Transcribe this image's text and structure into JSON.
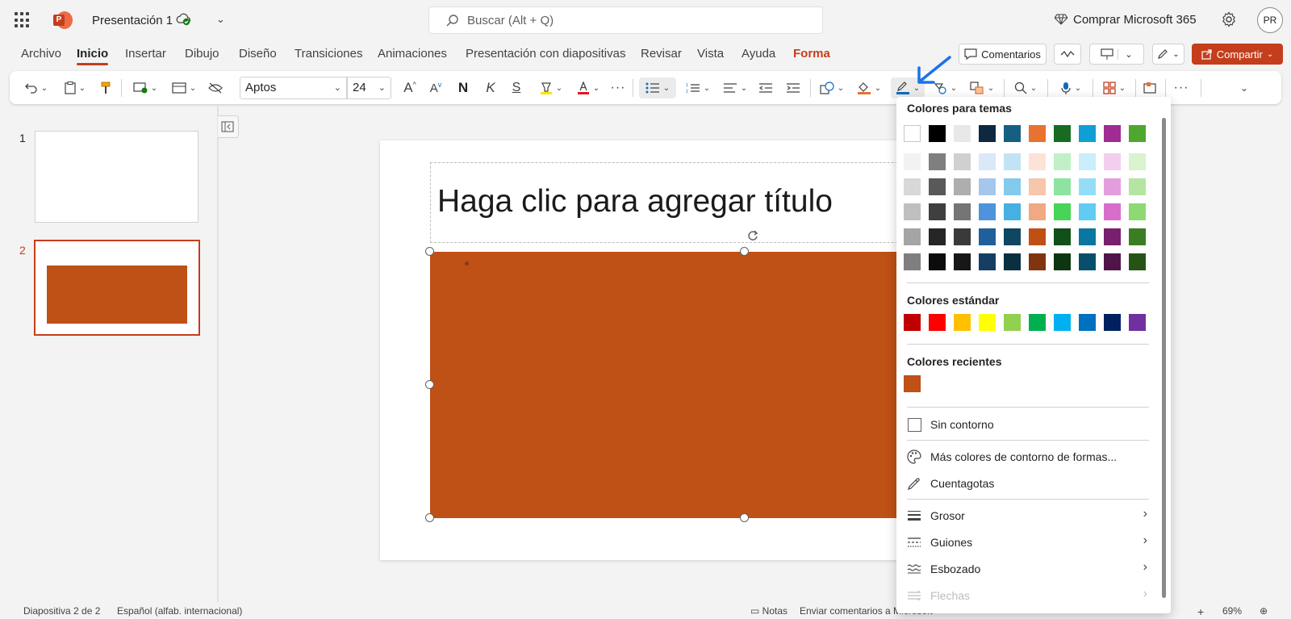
{
  "titlebar": {
    "doc_title": "Presentación 1",
    "search_placeholder": "Buscar (Alt + Q)",
    "buy_label": "Comprar Microsoft 365",
    "avatar_initials": "PR"
  },
  "menu": {
    "tabs": [
      "Archivo",
      "Inicio",
      "Insertar",
      "Dibujo",
      "Diseño",
      "Transiciones",
      "Animaciones",
      "Presentación con diapositivas",
      "Revisar",
      "Vista",
      "Ayuda",
      "Forma"
    ],
    "active_tab": "Inicio",
    "comments_label": "Comentarios",
    "share_label": "Compartir"
  },
  "ribbon": {
    "font_name": "Aptos",
    "font_size": "24",
    "bold_glyph": "N",
    "italic_glyph": "K",
    "strike_glyph": "S"
  },
  "slides": {
    "numbers": [
      "1",
      "2"
    ],
    "selected": "2"
  },
  "slide": {
    "title_placeholder": "Haga clic para agregar título",
    "shape_color": "#bf5016"
  },
  "panel": {
    "theme_heading": "Colores para temas",
    "standard_heading": "Colores estándar",
    "recent_heading": "Colores recientes",
    "theme_top_row": [
      "#ffffff",
      "#000000",
      "#e8e8e8",
      "#0e2841",
      "#156082",
      "#e97132",
      "#196b24",
      "#0f9ed5",
      "#a02b93",
      "#4ea72e"
    ],
    "theme_shades": [
      [
        "#f2f2f2",
        "#7f7f7f",
        "#d0d0d0",
        "#dbe8f7",
        "#c0e4f5",
        "#fbe3d6",
        "#c1f0c8",
        "#caeefb",
        "#f2cfee",
        "#d9f2d0"
      ],
      [
        "#d8d8d8",
        "#595959",
        "#aeaeae",
        "#a6c6ec",
        "#83caeb",
        "#f6c6ad",
        "#8ee3a0",
        "#95ddf7",
        "#e59edd",
        "#b4e5a2"
      ],
      [
        "#bfbfbf",
        "#3f3f3f",
        "#757575",
        "#4d94db",
        "#45b0e1",
        "#f1a983",
        "#47d459",
        "#61cbf3",
        "#d86ecc",
        "#8ed973"
      ],
      [
        "#a5a5a5",
        "#262626",
        "#3a3a3a",
        "#215f9a",
        "#0f4761",
        "#c04f15",
        "#12501a",
        "#0b76a0",
        "#78206e",
        "#3b7d23"
      ],
      [
        "#7f7f7f",
        "#0c0c0c",
        "#171717",
        "#163e64",
        "#0a2f40",
        "#80350e",
        "#0c3511",
        "#074f6a",
        "#4f1548",
        "#275317"
      ]
    ],
    "standard_colors": [
      "#c00000",
      "#ff0000",
      "#ffc000",
      "#ffff00",
      "#92d050",
      "#00b050",
      "#00b0f0",
      "#0070c0",
      "#002060",
      "#7030a0"
    ],
    "recent_colors": [
      "#bf5016"
    ],
    "items": {
      "no_outline": "Sin contorno",
      "more_colors": "Más colores de contorno de formas...",
      "eyedropper": "Cuentagotas",
      "weight": "Grosor",
      "dashes": "Guiones",
      "sketched": "Esbozado",
      "arrows": "Flechas"
    }
  },
  "status": {
    "slide_info": "Diapositiva 2 de 2",
    "language": "Español (alfab. internacional)",
    "notes": "Notas",
    "feedback": "Enviar comentarios a Microsoft",
    "zoom": "69%"
  }
}
